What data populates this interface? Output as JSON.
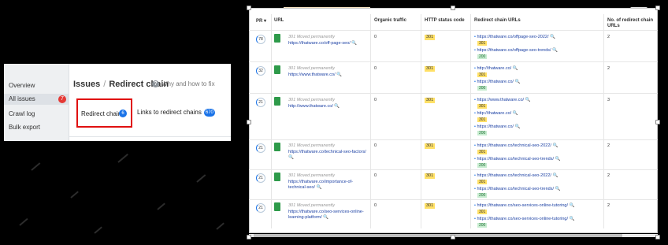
{
  "left_panel": {
    "nav": [
      {
        "label": "Overview"
      },
      {
        "label": "All issues",
        "badge": "7"
      },
      {
        "label": "Crawl log"
      },
      {
        "label": "Bulk export"
      }
    ],
    "breadcrumb": {
      "parent": "Issues",
      "separator": "/",
      "current": "Redirect chain"
    },
    "help_link": "Why and how to fix",
    "tabs": [
      {
        "label": "Redirect chains",
        "badge": "6"
      },
      {
        "label": "Links to redirect chains",
        "badge": "670"
      }
    ]
  },
  "table": {
    "columns": {
      "pr": "PR",
      "url": "URL",
      "traffic": "Organic traffic",
      "status": "HTTP status code",
      "chain": "Redirect chain URLs",
      "count": "No. of redirect chain URLs"
    },
    "rows": [
      {
        "pr": "78",
        "status_text": "301 Moved permanently",
        "url": "https://thatware.co/off-page-seo/",
        "traffic": "0",
        "code": "301",
        "chain": [
          {
            "url": "https://thatware.co/offpage-seo-2022/",
            "code": "301"
          },
          {
            "url": "https://thatware.co/offpage-seo-trends/",
            "code": "200"
          }
        ],
        "count": "2"
      },
      {
        "pr": "32",
        "status_text": "301 Moved permanently",
        "url": "https://www.thatware.co/",
        "traffic": "0",
        "code": "301",
        "chain": [
          {
            "url": "http://thatware.co/",
            "code": "301"
          },
          {
            "url": "https://thatware.co/",
            "code": "200"
          }
        ],
        "count": "2"
      },
      {
        "pr": "21",
        "status_text": "301 Moved permanently",
        "url": "http://www.thatware.co/",
        "traffic": "0",
        "code": "301",
        "chain": [
          {
            "url": "https://www.thatware.co/",
            "code": "301"
          },
          {
            "url": "http://thatware.co/",
            "code": "301"
          },
          {
            "url": "https://thatware.co/",
            "code": "200"
          }
        ],
        "count": "3"
      },
      {
        "pr": "21",
        "status_text": "301 Moved permanently",
        "url": "https://thatware.co/technical-seo-factors/",
        "traffic": "0",
        "code": "301",
        "chain": [
          {
            "url": "https://thatware.co/technical-seo-2022/",
            "code": "301"
          },
          {
            "url": "https://thatware.co/technical-seo-trends/",
            "code": "200"
          }
        ],
        "count": "2"
      },
      {
        "pr": "21",
        "status_text": "301 Moved permanently",
        "url": "https://thatware.co/importance-of-technical-seo/",
        "traffic": "0",
        "code": "301",
        "chain": [
          {
            "url": "https://thatware.co/technical-seo-2022/",
            "code": "301"
          },
          {
            "url": "https://thatware.co/technical-seo-trends/",
            "code": "200"
          }
        ],
        "count": "2"
      },
      {
        "pr": "21",
        "status_text": "301 Moved permanently",
        "url": "https://thatware.co/seo-services-online-learning-platform/",
        "traffic": "0",
        "code": "301",
        "chain": [
          {
            "url": "https://thatware.co/seo-services-online-tutoring/",
            "code": "301"
          },
          {
            "url": "https://thatware.co/seo-services-online-tutoring/",
            "code": "200"
          }
        ],
        "count": "2"
      }
    ]
  },
  "colors": {
    "accent": "#1a73e8",
    "badge_red": "#e53935",
    "highlight_red": "#e01010",
    "code_301": "#ffe066",
    "code_200": "#c7ecd0"
  }
}
